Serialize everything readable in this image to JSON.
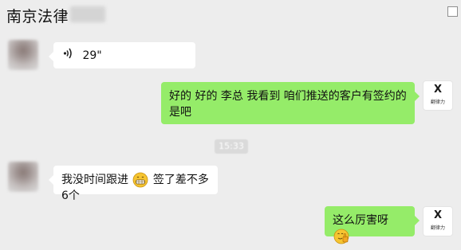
{
  "header": {
    "title": "南京法律"
  },
  "messages": [
    {
      "sender": "other",
      "type": "voice",
      "duration": "29\""
    },
    {
      "sender": "self",
      "type": "text",
      "line1": "好的 好的  李总 我看到 咱们推送的客户有签约的",
      "line2": "是吧"
    },
    {
      "sender": "other",
      "type": "text",
      "part1": "我没时间跟进",
      "emoji1": "grinning-face-icon",
      "part2": "签了差不多6个"
    },
    {
      "sender": "self",
      "type": "text",
      "part1": "这么厉害呀",
      "emoji1": "thumbs-up-face-icon"
    }
  ],
  "timestamp": "15:33",
  "self_avatar": {
    "mark": "X",
    "text": "翻律力"
  },
  "colors": {
    "background": "#ededed",
    "self_bubble": "#95ec69",
    "other_bubble": "#ffffff",
    "emoji": "#f6c531"
  }
}
